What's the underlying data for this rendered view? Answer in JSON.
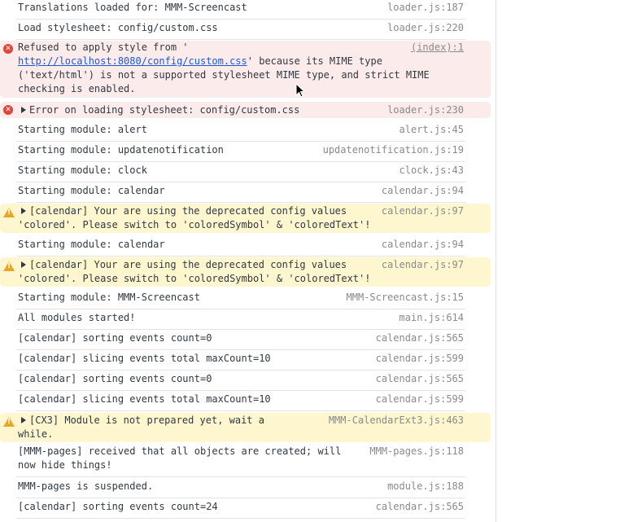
{
  "rows": [
    {
      "msg": "Translations loaded for: MMM-Screencast",
      "src": "loader.js:187"
    },
    {
      "msg": "Load stylesheet: config/custom.css",
      "src": "loader.js:220"
    }
  ],
  "error1": {
    "prefix": "Refused to apply style from '",
    "link": "http://localhost:8080/config/custom.css",
    "rest1": "' because its MIME type",
    "line2": "('text/html') is not a supported stylesheet MIME type, and strict MIME",
    "line3": "checking is enabled.",
    "src": "(index):1"
  },
  "error2": {
    "msg": "Error on loading stylesheet: config/custom.css",
    "src": "loader.js:230"
  },
  "rows2": [
    {
      "msg": "Starting module: alert",
      "src": "alert.js:45"
    },
    {
      "msg": "Starting module: updatenotification",
      "src": "updatenotification.js:19"
    },
    {
      "msg": "Starting module: clock",
      "src": "clock.js:43"
    },
    {
      "msg": "Starting module: calendar",
      "src": "calendar.js:94"
    }
  ],
  "warn1": {
    "line1": "[calendar] Your are using the deprecated config values",
    "line2": "'colored'. Please switch to 'coloredSymbol' & 'coloredText'!",
    "src": "calendar.js:97"
  },
  "row_cal2": {
    "msg": "Starting module: calendar",
    "src": "calendar.js:94"
  },
  "warn2": {
    "line1": "[calendar] Your are using the deprecated config values",
    "line2": "'colored'. Please switch to 'coloredSymbol' & 'coloredText'!",
    "src": "calendar.js:97"
  },
  "rows3": [
    {
      "msg": "Starting module: MMM-Screencast",
      "src": "MMM-Screencast.js:15"
    },
    {
      "msg": "All modules started!",
      "src": "main.js:614"
    },
    {
      "msg": "[calendar] sorting events count=0",
      "src": "calendar.js:565"
    },
    {
      "msg": "[calendar] slicing events total maxCount=10",
      "src": "calendar.js:599"
    },
    {
      "msg": "[calendar] sorting events count=0",
      "src": "calendar.js:565"
    },
    {
      "msg": "[calendar] slicing events total maxCount=10",
      "src": "calendar.js:599"
    }
  ],
  "warn3": {
    "line1": "[CX3] Module is not prepared yet, wait a",
    "line2": "while.",
    "src": "MMM-CalendarExt3.js:463"
  },
  "row_pages": {
    "line1": "[MMM-pages] received that all objects are created; will",
    "line2": "now hide things!",
    "src": "MMM-pages.js:118"
  },
  "rows4": [
    {
      "msg": "MMM-pages is suspended.",
      "src": "module.js:188"
    },
    {
      "msg": "[calendar] sorting events count=24",
      "src": "calendar.js:565"
    }
  ],
  "icons": {
    "error": "error-circle-icon",
    "warning": "warning-triangle-icon",
    "expand": "expand-triangle-icon"
  },
  "colors": {
    "error_bg": "#fcebeb",
    "warn_bg": "#fdf6cf",
    "link": "#1a5ad9",
    "source": "#8a8a8a"
  }
}
